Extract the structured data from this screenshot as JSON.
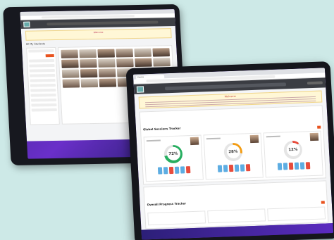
{
  "colors": {
    "accent": "#e8531f",
    "teal": "#2a9d8f",
    "header": "#3b3d43",
    "notice_bg": "#fff7d6"
  },
  "back_tablet": {
    "notice_heading": "Welcome",
    "page_title": "All My Students"
  },
  "front_tablet": {
    "tab_title": "Home",
    "address": "",
    "notice_heading": "Welcome",
    "crumb": "",
    "tracker": {
      "tag": "",
      "title": "Global Sessions Tracker",
      "students": [
        {
          "name": "",
          "percent": 72,
          "color": "#27ae60",
          "stats": [
            "#5dade2",
            "#5dade2",
            "#e74c3c",
            "#5dade2",
            "#5dade2",
            "#e74c3c"
          ]
        },
        {
          "name": "",
          "percent": 28,
          "color": "#f39c12",
          "stats": [
            "#5dade2",
            "#5dade2",
            "#e74c3c",
            "#5dade2",
            "#5dade2",
            "#e74c3c"
          ]
        },
        {
          "name": "",
          "percent": 12,
          "color": "#e74c3c",
          "stats": [
            "#5dade2",
            "#5dade2",
            "#e74c3c",
            "#5dade2",
            "#5dade2",
            "#e74c3c"
          ]
        }
      ]
    },
    "progress": {
      "tag": "",
      "title": "Overall Progress Tracker",
      "columns": [
        "",
        "",
        ""
      ]
    }
  }
}
